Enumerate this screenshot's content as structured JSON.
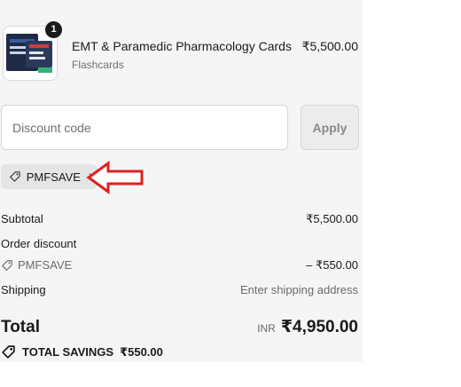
{
  "cart": {
    "item": {
      "quantity": "1",
      "name": "EMT & Paramedic Pharmacology Cards",
      "type": "Flashcards",
      "price": "₹5,500.00",
      "thumbnail_icon": "product-thumbnail"
    }
  },
  "discount": {
    "placeholder": "Discount code",
    "apply_label": "Apply",
    "applied_code": "PMFSAVE",
    "tag_icon": "tag-icon"
  },
  "annotation": {
    "arrow_color": "#e02020"
  },
  "summary": {
    "subtotal_label": "Subtotal",
    "subtotal_value": "₹5,500.00",
    "order_discount_label": "Order discount",
    "discount_code": "PMFSAVE",
    "discount_value": "– ₹550.00",
    "shipping_label": "Shipping",
    "shipping_value": "Enter shipping address",
    "total_label": "Total",
    "currency": "INR",
    "total_value": "₹4,950.00",
    "savings_label": "TOTAL SAVINGS",
    "savings_value": "₹550.00"
  }
}
